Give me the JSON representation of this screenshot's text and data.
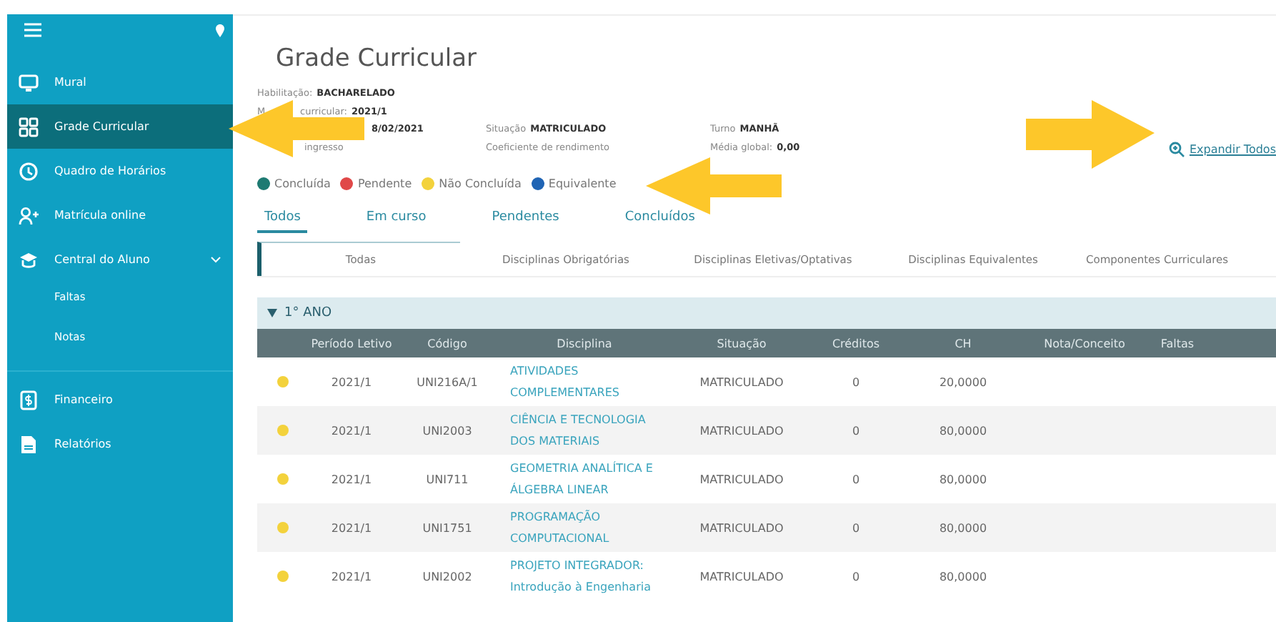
{
  "sidebar": {
    "items": [
      {
        "label": "Mural",
        "selected": false
      },
      {
        "label": "Grade Curricular",
        "selected": true
      },
      {
        "label": "Quadro de Horários",
        "selected": false
      },
      {
        "label": "Matrícula online",
        "selected": false
      },
      {
        "label": "Central do Aluno",
        "selected": false,
        "expanded": true,
        "children": [
          {
            "label": "Faltas",
            "selected": false
          },
          {
            "label": "Notas",
            "selected": false
          }
        ]
      },
      {
        "label": "Financeiro",
        "selected": false,
        "divider_before": true
      },
      {
        "label": "Relatórios",
        "selected": false
      }
    ]
  },
  "page": {
    "title": "Grade Curricular",
    "info_rows": [
      [
        {
          "label": "Habilitação:",
          "value": "BACHARELADO"
        }
      ],
      [
        {
          "label": "M"
        },
        {
          "label": "curricular:",
          "value": "2021/1"
        }
      ],
      [
        {
          "value": "8/02/2021"
        },
        {
          "label": "Situação",
          "value": "MATRICULADO"
        },
        {
          "label": "Turno",
          "value": "MANHÃ"
        }
      ],
      [
        {
          "label": "ingresso"
        },
        {
          "label": "Coeficiente de rendimento"
        },
        {
          "label": "Média global:",
          "value": "0,00"
        }
      ]
    ],
    "expand_link": "Expandir Todos",
    "legend": [
      {
        "label": "Concluída",
        "color": "#1e7a72"
      },
      {
        "label": "Pendente",
        "color": "#e04848"
      },
      {
        "label": "Não Concluída",
        "color": "#f3d23c"
      },
      {
        "label": "Equivalente",
        "color": "#1f64b4"
      }
    ],
    "tabs": [
      {
        "label": "Todos",
        "selected": true
      },
      {
        "label": "Em curso",
        "selected": false
      },
      {
        "label": "Pendentes",
        "selected": false
      },
      {
        "label": "Concluídos",
        "selected": false
      }
    ],
    "subtabs": [
      {
        "label": "Todas",
        "selected": true
      },
      {
        "label": "Disciplinas Obrigatórias",
        "selected": false
      },
      {
        "label": "Disciplinas Eletivas/Optativas",
        "selected": false
      },
      {
        "label": "Disciplinas Equivalentes",
        "selected": false
      },
      {
        "label": "Componentes Curriculares",
        "selected": false
      }
    ]
  },
  "group": {
    "label": "1° ANO",
    "expanded": true
  },
  "table": {
    "columns": [
      "Período Letivo",
      "Código",
      "Disciplina",
      "Situação",
      "Créditos",
      "CH",
      "Nota/Conceito",
      "Faltas"
    ],
    "rows": [
      {
        "color": "#f3d23c",
        "cells": [
          "2021/1",
          "UNI216A/1",
          "ATIVIDADES COMPLEMENTARES",
          "MATRICULADO",
          "0",
          "20,0000"
        ]
      },
      {
        "color": "#f3d23c",
        "cells": [
          "2021/1",
          "UNI2003",
          "CIÊNCIA E TECNOLOGIA DOS MATERIAIS",
          "MATRICULADO",
          "0",
          "80,0000"
        ]
      },
      {
        "color": "#f3d23c",
        "cells": [
          "2021/1",
          "UNI711",
          "GEOMETRIA ANALÍTICA E ÁLGEBRA LINEAR",
          "MATRICULADO",
          "0",
          "80,0000"
        ]
      },
      {
        "color": "#f3d23c",
        "cells": [
          "2021/1",
          "UNI1751",
          "PROGRAMAÇÃO COMPUTACIONAL",
          "MATRICULADO",
          "0",
          "80,0000"
        ]
      },
      {
        "color": "#f3d23c",
        "cells": [
          "2021/1",
          "UNI2002",
          "PROJETO INTEGRADOR: Introdução à Engenharia",
          "MATRICULADO",
          "0",
          "80,0000"
        ]
      }
    ]
  },
  "annotations": [
    {
      "kind": "arrow-left"
    },
    {
      "kind": "arrow-left"
    },
    {
      "kind": "arrow-right"
    }
  ]
}
